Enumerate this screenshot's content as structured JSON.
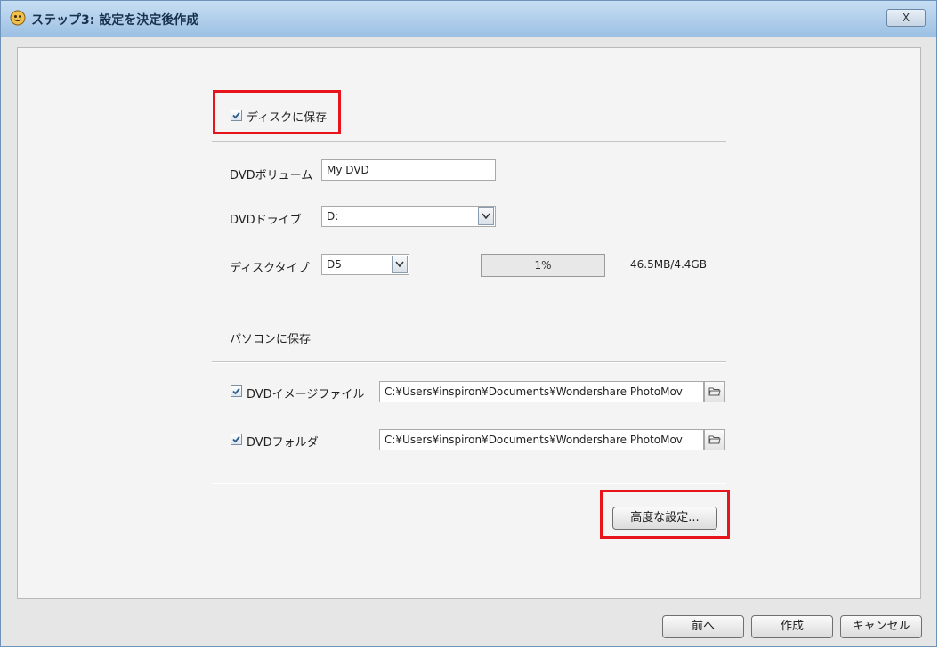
{
  "window": {
    "title": "ステップ3: 設定を決定後作成",
    "close_label": "X"
  },
  "disc": {
    "checkbox_label": "ディスクに保存",
    "checked": true,
    "volume_label": "DVDボリューム",
    "volume_value": "My DVD",
    "drive_label": "DVDドライブ",
    "drive_value": "D:",
    "disctype_label": "ディスクタイプ",
    "disctype_value": "D5",
    "progress_text": "1%",
    "progress_value": 0.01,
    "size_text": "46.5MB/4.4GB"
  },
  "pc": {
    "section_label": "パソコンに保存",
    "image_file_label": "DVDイメージファイル",
    "image_file_checked": true,
    "image_file_path": "C:¥Users¥inspiron¥Documents¥Wondershare PhotoMov",
    "folder_label": "DVDフォルダ",
    "folder_checked": true,
    "folder_path": "C:¥Users¥inspiron¥Documents¥Wondershare PhotoMov"
  },
  "advanced_button": "高度な設定...",
  "footer": {
    "back_button": "前へ",
    "create_button": "作成",
    "cancel_button": "キャンセル"
  },
  "colors": {
    "highlight": "#e8141b",
    "titlebar": "#9cc0e3"
  },
  "icons": [
    "app-icon",
    "close-icon",
    "checkbox-check-icon",
    "chevron-down-icon",
    "folder-icon"
  ]
}
